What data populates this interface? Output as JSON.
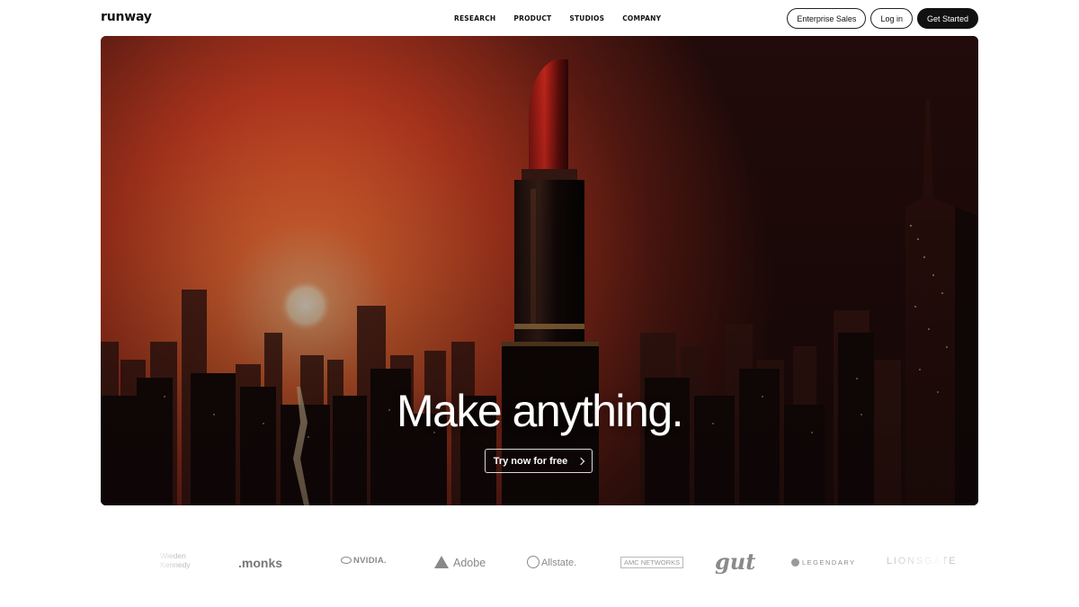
{
  "header": {
    "logo": "runway",
    "nav": [
      "RESEARCH",
      "PRODUCT",
      "STUDIOS",
      "COMPANY"
    ],
    "enterprise_label": "Enterprise Sales",
    "login_label": "Log in",
    "get_started_label": "Get Started"
  },
  "hero": {
    "headline": "Make anything.",
    "cta_label": "Try now for free",
    "colors": {
      "sky_top": "#3a120c",
      "sky_glow": "#e8552a",
      "sun": "#fbe3c6"
    }
  },
  "brands": {
    "wieden_line1": "Wieden",
    "wieden_line2": "Kennedy",
    "monks": ".monks",
    "nvidia": "NVIDIA.",
    "adobe": "Adobe",
    "allstate": "Allstate.",
    "amc": "AMC NETWORKS",
    "gut": "gut",
    "legendary": "LEGENDARY",
    "lionsgate": "LIONSGATE"
  }
}
